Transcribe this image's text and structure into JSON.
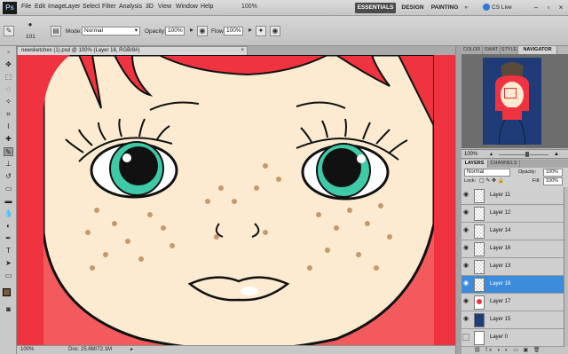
{
  "app": {
    "logo": "Ps"
  },
  "menu": [
    "File",
    "Edit",
    "Image",
    "Layer",
    "Select",
    "Filter",
    "Analysis",
    "3D",
    "View",
    "Window",
    "Help"
  ],
  "appbar": {
    "zoom": "100%",
    "workspaces": [
      "ESSENTIALS",
      "DESIGN",
      "PAINTING"
    ],
    "more": "»",
    "cs_live": "CS Live"
  },
  "options": {
    "brush_size": "101",
    "mode_label": "Mode:",
    "mode_value": "Normal",
    "opacity_label": "Opacity:",
    "opacity_value": "100%",
    "flow_label": "Flow:",
    "flow_value": "100%"
  },
  "document": {
    "tab_title": "newsketchex (1).psd @ 100% (Layer 18, RGB/8#)"
  },
  "status": {
    "zoom": "100%",
    "doc": "Doc: 25.6M/72.1M"
  },
  "panels": {
    "top_tabs": [
      "COLOR",
      "SWAT",
      "STYLE",
      "NAVIGATOR"
    ],
    "nav_zoom": "100%",
    "layer_tabs": [
      "LAYERS",
      "CHANNELS"
    ],
    "blend_mode": "Normal",
    "opacity_label": "Opacity:",
    "opacity_value": "100%",
    "lock_label": "Lock:",
    "fill_label": "Fill:",
    "fill_value": "100%",
    "layers": [
      {
        "name": "Layer 11",
        "selected": false
      },
      {
        "name": "Layer 12",
        "selected": false
      },
      {
        "name": "Layer 14",
        "selected": false
      },
      {
        "name": "Layer 16",
        "selected": false
      },
      {
        "name": "Layer 13",
        "selected": false
      },
      {
        "name": "Layer 18",
        "selected": true
      },
      {
        "name": "Layer 17",
        "selected": false
      },
      {
        "name": "Layer 15",
        "selected": false
      },
      {
        "name": "Layer 0",
        "selected": false
      }
    ]
  },
  "colors": {
    "background": "#f25a5e",
    "skin": "#fcebd0",
    "hair": "#ef3340",
    "iris": "#3ec9a7",
    "freckle": "#c49a6c",
    "selected": "#3d8bdb"
  }
}
